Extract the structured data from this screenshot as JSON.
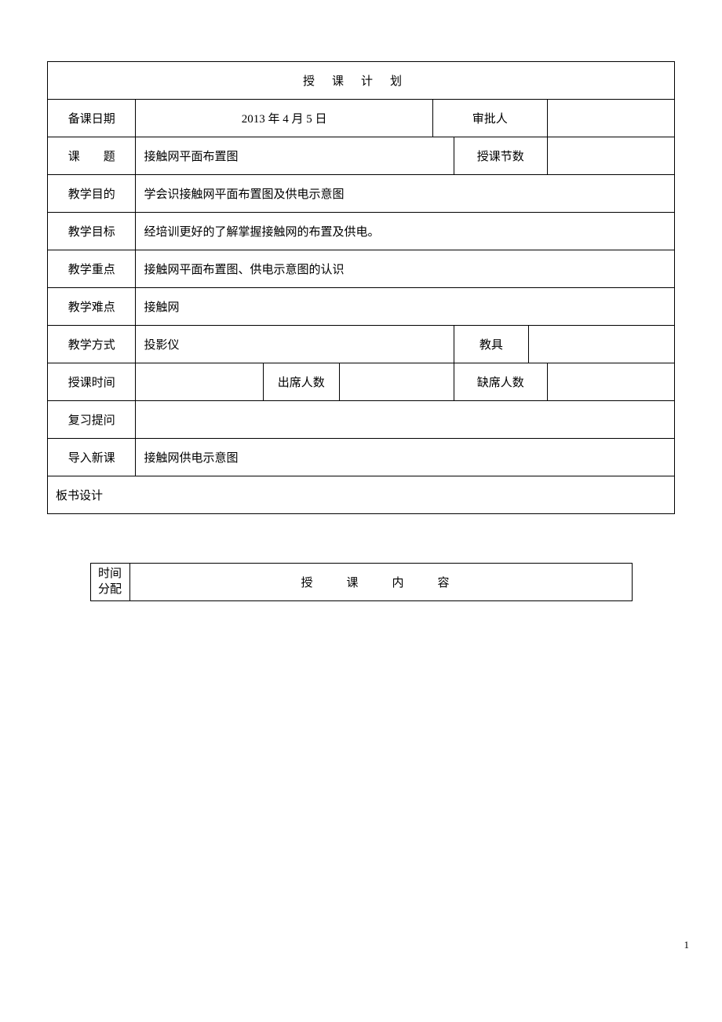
{
  "title": "授课计划",
  "rows": {
    "prep_date": {
      "label": "备课日期",
      "value": "2013 年 4 月 5 日",
      "approver_label": "审批人",
      "approver_value": ""
    },
    "subject": {
      "label": "课　　题",
      "value": "接触网平面布置图",
      "periods_label": "授课节数",
      "periods_value": ""
    },
    "purpose": {
      "label": "教学目的",
      "value": "学会识接触网平面布置图及供电示意图"
    },
    "goal": {
      "label": "教学目标",
      "value": "经培训更好的了解掌握接触网的布置及供电。"
    },
    "focus": {
      "label": "教学重点",
      "value": "接触网平面布置图、供电示意图的认识"
    },
    "difficulty": {
      "label": "教学难点",
      "value": "接触网"
    },
    "method": {
      "label": "教学方式",
      "value": "投影仪",
      "aid_label": "教具",
      "aid_value": ""
    },
    "time": {
      "label": "授课时间",
      "value": "",
      "present_label": "出席人数",
      "present_value": "",
      "absent_label": "缺席人数",
      "absent_value": ""
    },
    "review": {
      "label": "复习提问",
      "value": ""
    },
    "intro": {
      "label": "导入新课",
      "value": "接触网供电示意图"
    },
    "board": {
      "label": "板书设计",
      "value": ""
    }
  },
  "content_table": {
    "time_alloc": "时间\n分配",
    "content_title": "授　课　内　容"
  },
  "page_number": "1"
}
